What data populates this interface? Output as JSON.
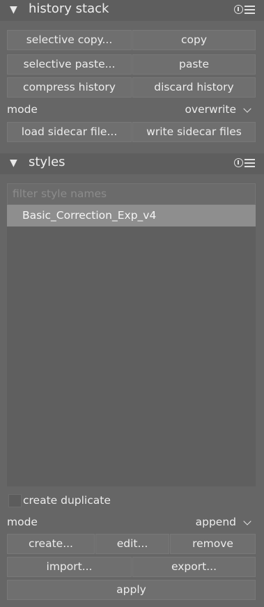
{
  "history_stack": {
    "title": "history stack",
    "buttons": {
      "selective_copy": "selective copy...",
      "copy": "copy",
      "selective_paste": "selective paste...",
      "paste": "paste",
      "compress_history": "compress history",
      "discard_history": "discard history",
      "load_sidecar": "load sidecar file...",
      "write_sidecar": "write sidecar files"
    },
    "mode_label": "mode",
    "mode_value": "overwrite"
  },
  "styles": {
    "title": "styles",
    "filter_placeholder": "filter style names",
    "items": [
      "Basic_Correction_Exp_v4"
    ],
    "create_duplicate_label": "create duplicate",
    "create_duplicate_checked": false,
    "mode_label": "mode",
    "mode_value": "append",
    "buttons": {
      "create": "create...",
      "edit": "edit...",
      "remove": "remove",
      "import": "import...",
      "export": "export...",
      "apply": "apply"
    }
  }
}
